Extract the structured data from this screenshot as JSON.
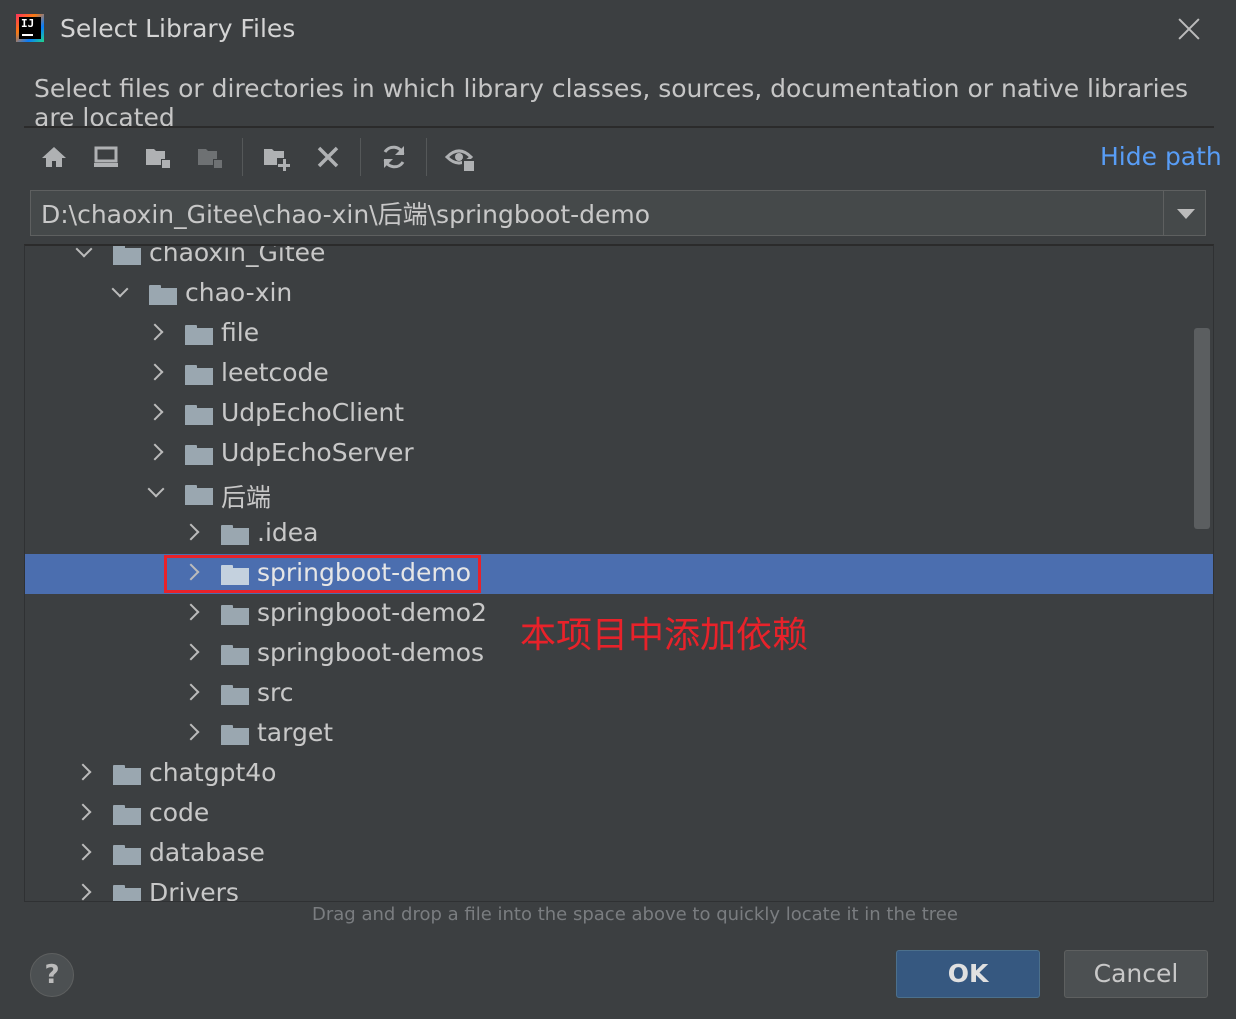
{
  "dialog": {
    "title": "Select Library Files",
    "description": "Select files or directories in which library classes, sources, documentation or native libraries are located"
  },
  "toolbar": {
    "icons": [
      "home-icon",
      "desktop-icon",
      "project-folder-icon",
      "module-folder-icon",
      "new-folder-icon",
      "delete-icon",
      "refresh-icon",
      "show-hidden-icon"
    ],
    "hide_path_label": "Hide path"
  },
  "path_field": {
    "value": "D:\\chaoxin_Gitee\\chao-xin\\后端\\springboot-demo"
  },
  "tree": {
    "rows": [
      {
        "label": "chaoxin_Gitee",
        "expanded": true,
        "level": 1
      },
      {
        "label": "chao-xin",
        "expanded": true,
        "level": 2
      },
      {
        "label": "file",
        "expanded": false,
        "level": 3
      },
      {
        "label": "leetcode",
        "expanded": false,
        "level": 3
      },
      {
        "label": "UdpEchoClient",
        "expanded": false,
        "level": 3
      },
      {
        "label": "UdpEchoServer",
        "expanded": false,
        "level": 3
      },
      {
        "label": "后端",
        "expanded": true,
        "level": 3
      },
      {
        "label": ".idea",
        "expanded": false,
        "level": 4
      },
      {
        "label": "springboot-demo",
        "expanded": false,
        "level": 4,
        "selected": true
      },
      {
        "label": "springboot-demo2",
        "expanded": false,
        "level": 4
      },
      {
        "label": "springboot-demos",
        "expanded": false,
        "level": 4
      },
      {
        "label": "src",
        "expanded": false,
        "level": 4
      },
      {
        "label": "target",
        "expanded": false,
        "level": 4
      },
      {
        "label": "chatgpt4o",
        "expanded": false,
        "level": 1
      },
      {
        "label": "code",
        "expanded": false,
        "level": 1
      },
      {
        "label": "database",
        "expanded": false,
        "level": 1
      },
      {
        "label": "Drivers",
        "expanded": false,
        "level": 1
      }
    ]
  },
  "annotation": {
    "text": "本项目中添加依赖",
    "color": "#e8222a"
  },
  "hint": "Drag and drop a file into the space above to quickly locate it in the tree",
  "buttons": {
    "help": "?",
    "ok": "OK",
    "cancel": "Cancel"
  },
  "colors": {
    "background": "#3c3f41",
    "selection": "#4b6eaf",
    "link": "#589df6",
    "primary_button": "#365880"
  }
}
